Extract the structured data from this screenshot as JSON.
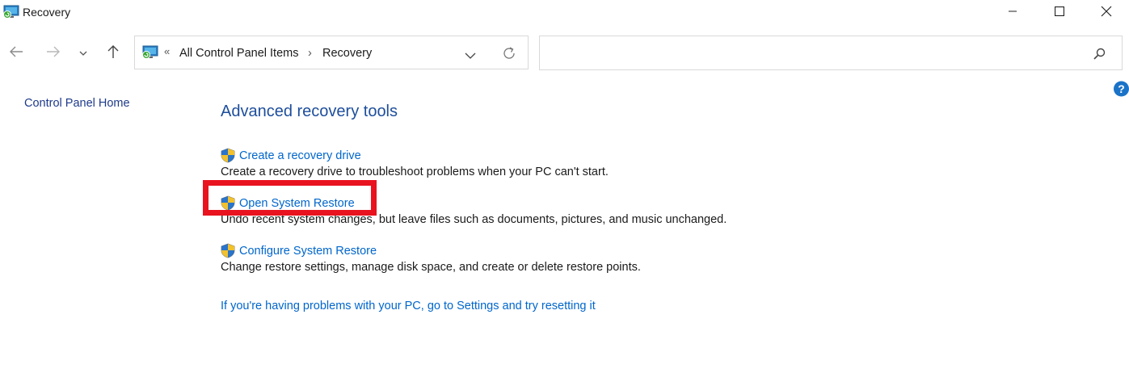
{
  "window": {
    "title": "Recovery",
    "icon": "recovery-control-panel-icon",
    "controls": [
      "minimize-icon",
      "maximize-icon",
      "close-icon"
    ]
  },
  "nav": {
    "back": "back-arrow-icon",
    "forward": "forward-arrow-icon",
    "recent": "chevron-down-icon",
    "up": "up-arrow-icon"
  },
  "address_bar": {
    "overflow": "«",
    "crumbs": [
      "All Control Panel Items",
      "Recovery"
    ],
    "separator": "›",
    "dropdown_icon": "chevron-down-icon",
    "refresh_icon": "refresh-icon"
  },
  "search": {
    "value": "",
    "icon": "search-icon"
  },
  "sidebar": {
    "home_link": "Control Panel Home"
  },
  "main": {
    "heading": "Advanced recovery tools",
    "tasks": [
      {
        "link": "Create a recovery drive",
        "description": "Create a recovery drive to troubleshoot problems when your PC can't start."
      },
      {
        "link": "Open System Restore",
        "description": "Undo recent system changes, but leave files such as documents, pictures, and music unchanged."
      },
      {
        "link": "Configure System Restore",
        "description": "Change restore settings, manage disk space, and create or delete restore points."
      }
    ],
    "reset_link": "If you're having problems with your PC, go to Settings and try resetting it"
  },
  "colors": {
    "link": "#0066cc",
    "heading": "#1e4e9c",
    "highlight": "#e8131f"
  }
}
